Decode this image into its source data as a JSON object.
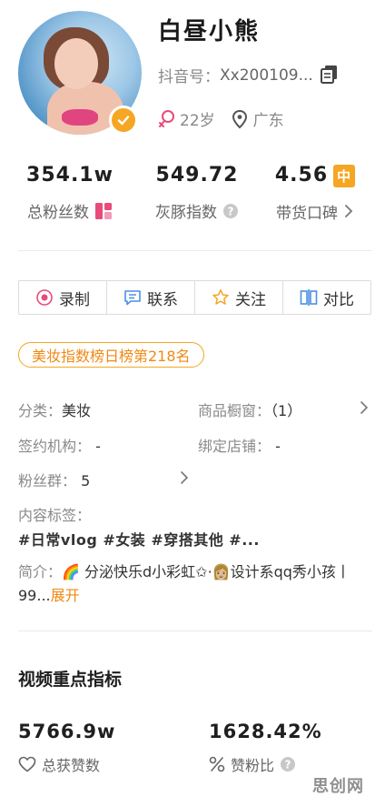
{
  "profile": {
    "name": "白昼小熊",
    "id_label": "抖音号：",
    "id_value": "Xx200109...",
    "age": "22岁",
    "location": "广东"
  },
  "stats": [
    {
      "value": "354.1w",
      "label": "总粉丝数"
    },
    {
      "value": "549.72",
      "label": "灰豚指数"
    },
    {
      "value": "4.56",
      "badge": "中",
      "label": "带货口碑"
    }
  ],
  "actions": {
    "record": "录制",
    "contact": "联系",
    "follow": "关注",
    "compare": "对比"
  },
  "rank_badge": "美妆指数榜日榜第218名",
  "info": {
    "category_label": "分类：",
    "category_value": "美妆",
    "showcase_label": "商品橱窗：",
    "showcase_value": "（1）",
    "agency_label": "签约机构：",
    "agency_value": "-",
    "store_label": "绑定店铺：",
    "store_value": "-",
    "fan_group_label": "粉丝群：",
    "fan_group_value": "5",
    "content_tags_label": "内容标签：",
    "content_tags": "#日常vlog  #女装  #穿搭其他  #...",
    "intro_label": "简介：",
    "intro_text": "🌈 分泌快乐d小彩虹✩·👩🏼设计系qq秀小孩丨99...",
    "intro_more": "展开"
  },
  "video_section": {
    "title": "视频重点指标",
    "likes_value": "5766.9w",
    "likes_label": "总获赞数",
    "ratio_value": "1628.42%",
    "ratio_label": "赞粉比"
  },
  "watermark": "思创网",
  "colors": {
    "accent": "#f5a623",
    "rank_text": "#f08a14",
    "pink": "#e84b7a",
    "blue": "#4a90e2"
  }
}
